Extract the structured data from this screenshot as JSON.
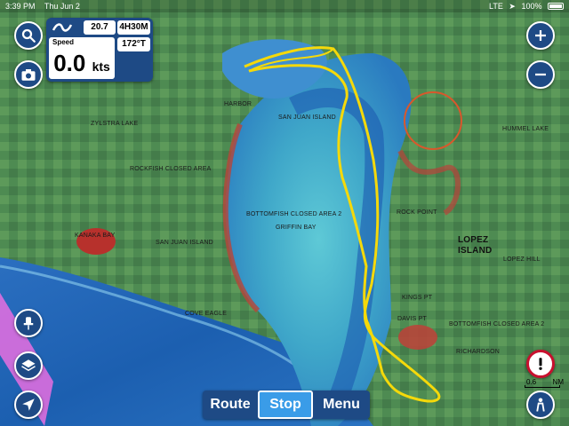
{
  "status_bar": {
    "time": "3:39 PM",
    "date": "Thu Jun 2",
    "network": "LTE",
    "battery": "100%"
  },
  "nav_panel": {
    "distance": "20.7 NM",
    "time_to_go": "4H30M",
    "speed_label": "Speed",
    "speed_value": "0.0",
    "speed_unit": "kts",
    "heading": "172°T"
  },
  "toolbar": {
    "route_label": "Route",
    "stop_label": "Stop",
    "menu_label": "Menu"
  },
  "scale": {
    "left": "0.6",
    "right": "NM"
  },
  "icons": {
    "search": "search-icon",
    "camera": "camera-icon",
    "zoom_in": "plus-icon",
    "zoom_out": "minus-icon",
    "pin": "pin-icon",
    "layers": "layers-icon",
    "locate": "location-arrow-icon",
    "warning": "exclamation-icon",
    "person": "person-icon"
  },
  "map_labels": [
    "LOPEZ",
    "ISLAND",
    "ROCKFISH CLOSED AREA",
    "BOTTOMFISH CLOSED AREA 2",
    "GRIFFIN BAY",
    "SAN JUAN ISLAND",
    "KANAKA BAY",
    "COVE EAGLE",
    "ROCK POINT",
    "HUMMEL LAKE",
    "RICHARDSON",
    "KINGS PT",
    "DAVIS PT",
    "BOTTOMFISH CLOSED AREA 2",
    "HARBOR",
    "SAN JUAN ISLAND",
    "ZYLSTRA LAKE",
    "LOPEZ HILL"
  ],
  "colors": {
    "panel": "#1e4a85",
    "track": "#f5d90a",
    "highlight": "#3a9ce8",
    "warning": "#c8102e"
  }
}
